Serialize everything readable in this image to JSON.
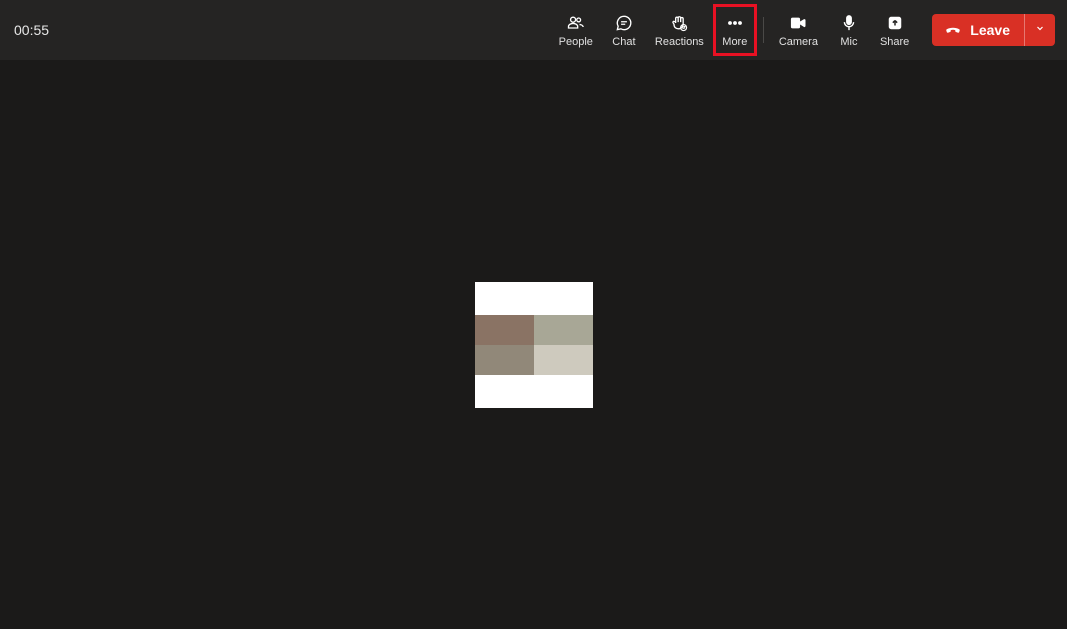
{
  "call": {
    "timer": "00:55"
  },
  "toolbar": {
    "people": "People",
    "chat": "Chat",
    "reactions": "Reactions",
    "more": "More",
    "camera": "Camera",
    "mic": "Mic",
    "share": "Share"
  },
  "leave": {
    "label": "Leave"
  },
  "highlighted_control": "more"
}
